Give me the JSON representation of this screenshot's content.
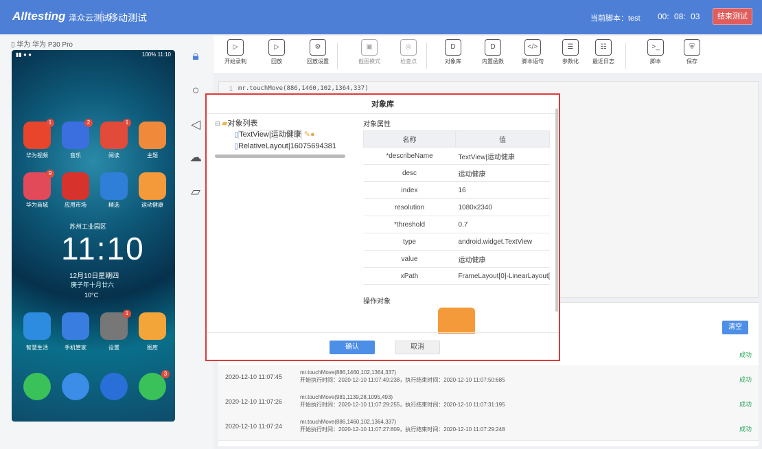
{
  "header": {
    "logo": "Alltesting",
    "logo_sub": "泽众云测试",
    "title": "移动测试",
    "script_label": "当前脚本：test",
    "timer": "00: 08: 03",
    "end_button": "结束测试",
    "brand_color": "#4d7fd6"
  },
  "device": {
    "name": "华为 华为 P30 Pro",
    "status_right": "100% 11:10",
    "clock": "11:10",
    "location": "苏州工业园区",
    "date": "12月10日星期四",
    "lunar": "庚子年十月廿六",
    "temp": "10°C",
    "apps": [
      {
        "label": "华为视频",
        "icon": "video-icon",
        "badge": "1",
        "color": "#e8452c"
      },
      {
        "label": "音乐",
        "icon": "music-icon",
        "badge": "2",
        "color": "#3b6fe0"
      },
      {
        "label": "阅读",
        "icon": "book-icon",
        "badge": "1",
        "color": "#e24a3a"
      },
      {
        "label": "主题",
        "icon": "brush-icon",
        "badge": "",
        "color": "#f08a3a"
      },
      {
        "label": "华为商城",
        "icon": "vmall-icon",
        "badge": "9",
        "color": "#e24a5a"
      },
      {
        "label": "应用市场",
        "icon": "huawei-icon",
        "badge": "",
        "color": "#d8322c"
      },
      {
        "label": "精选",
        "icon": "card-icon",
        "badge": "",
        "color": "#2f7fd8"
      },
      {
        "label": "运动健康",
        "icon": "health-icon",
        "badge": "",
        "color": "#f49a3a"
      },
      {
        "label": "智慧生活",
        "icon": "home-icon",
        "badge": "",
        "color": "#2d8be0"
      },
      {
        "label": "手机管家",
        "icon": "shield-icon",
        "badge": "",
        "color": "#3a7de0"
      },
      {
        "label": "设置",
        "icon": "settings-icon",
        "badge": "1",
        "color": "#777"
      },
      {
        "label": "图库",
        "icon": "gallery-icon",
        "badge": "",
        "color": "#f3a53a"
      },
      {
        "label": "",
        "icon": "phone-icon",
        "badge": "",
        "color": "#3bc15a"
      },
      {
        "label": "",
        "icon": "message-icon",
        "badge": "",
        "color": "#3b8de8"
      },
      {
        "label": "",
        "icon": "browser-icon",
        "badge": "",
        "color": "#2a6fd8"
      },
      {
        "label": "",
        "icon": "wechat-icon",
        "badge": "3",
        "color": "#3bc15a"
      }
    ]
  },
  "toolbar": {
    "items": [
      {
        "label": "开始录制",
        "icon": "record-icon",
        "glyph": "▷"
      },
      {
        "label": "回放",
        "icon": "playback-icon",
        "glyph": "▷"
      },
      {
        "label": "回放设置",
        "icon": "gear-icon",
        "glyph": "⚙"
      },
      {
        "label": "截图模式",
        "icon": "screenshot-icon",
        "glyph": "▣"
      },
      {
        "label": "检查点",
        "icon": "checkpoint-icon",
        "glyph": "◎"
      },
      {
        "label": "对象库",
        "icon": "object-lib-icon",
        "glyph": "D"
      },
      {
        "label": "内置函数",
        "icon": "function-icon",
        "glyph": "D"
      },
      {
        "label": "脚本语句",
        "icon": "code-icon",
        "glyph": "</>"
      },
      {
        "label": "参数化",
        "icon": "param-icon",
        "glyph": "☰"
      },
      {
        "label": "最近日志",
        "icon": "log-icon",
        "glyph": "☷"
      },
      {
        "label": "脚本",
        "icon": "script-icon",
        "glyph": ">_"
      },
      {
        "label": "保存",
        "icon": "save-icon",
        "glyph": "⛨"
      }
    ]
  },
  "editor": {
    "line_no": "1",
    "code": "mr.touchMove(886,1460,102,1364,337)"
  },
  "dialog": {
    "title": "对象库",
    "tree_root": "对象列表",
    "tree_items": [
      "TextView|运动健康",
      "RelativeLayout|16075694381"
    ],
    "props_label": "对象属性",
    "col_name": "名称",
    "col_value": "值",
    "props": [
      {
        "k": "*describeName",
        "v": "TextView|运动健康"
      },
      {
        "k": "desc",
        "v": "运动健康"
      },
      {
        "k": "index",
        "v": "16"
      },
      {
        "k": "resolution",
        "v": "1080x2340"
      },
      {
        "k": "*threshold",
        "v": "0.7"
      },
      {
        "k": "type",
        "v": "android.widget.TextView"
      },
      {
        "k": "value",
        "v": "运动健康"
      },
      {
        "k": "xPath",
        "v": "FrameLayout[0]-LinearLayout["
      }
    ],
    "op_label": "操作对象",
    "ok": "确认",
    "cancel": "取消",
    "highlight_color": "#e03a3a"
  },
  "log": {
    "clear": "清空",
    "rows": [
      {
        "time": "",
        "cmd": "",
        "detail": "",
        "status": "成功"
      },
      {
        "time": "2020-12-10 11:07:45",
        "cmd": "mr.touchMove(886,1460,102,1364,337)",
        "detail": "开始执行时间：2020-12-10 11:07:49:238，执行结束时间：2020-12-10 11:07:50:685",
        "status": "成功"
      },
      {
        "time": "2020-12-10 11:07:26",
        "cmd": "mr.touchMove(981,1139,28,1095,493)",
        "detail": "开始执行时间：2020-12-10 11:07:29:255，执行结束时间：2020-12-10 11:07:31:195",
        "status": "成功"
      },
      {
        "time": "2020-12-10 11:07:24",
        "cmd": "mr.touchMove(886,1460,102,1364,337)",
        "detail": "开始执行时间：2020-12-10 11:07:27:809，执行结束时间：2020-12-10 11:07:29:248",
        "status": "成功"
      }
    ]
  }
}
